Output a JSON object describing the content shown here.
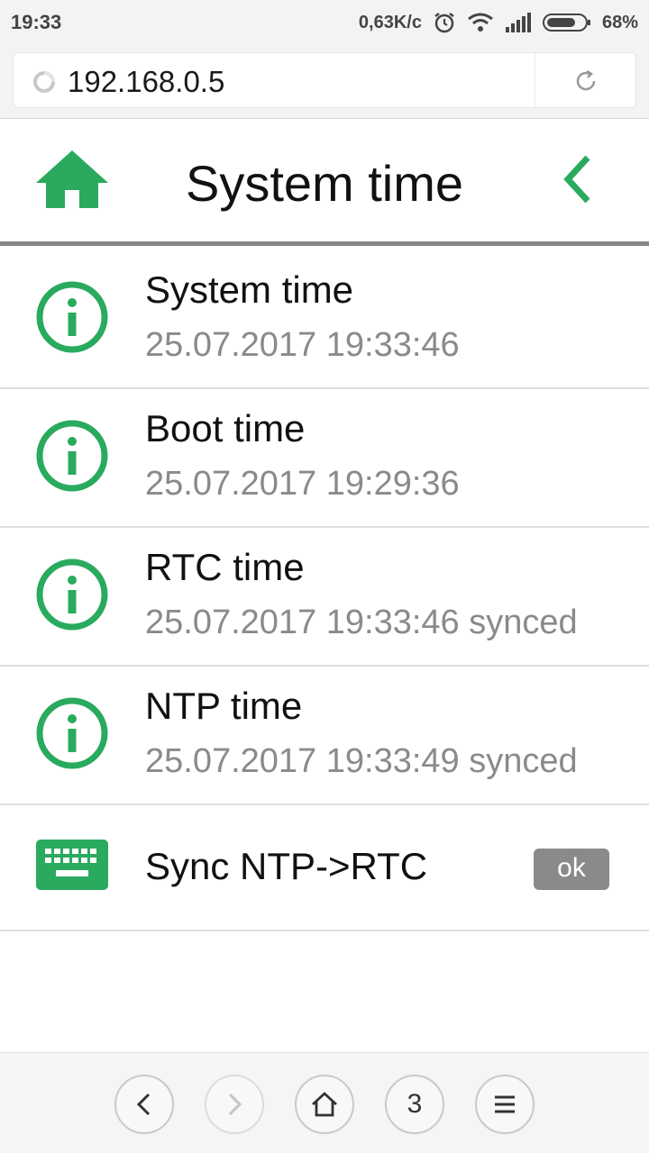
{
  "status_bar": {
    "time": "19:33",
    "net_speed": "0,63K/c",
    "battery": "68%",
    "icons": [
      "alarm-icon",
      "wifi-icon",
      "signal-icon",
      "battery-icon"
    ]
  },
  "browser": {
    "url": "192.168.0.5",
    "tab_count": "3"
  },
  "header": {
    "title": "System time"
  },
  "colors": {
    "accent": "#2aaa5e",
    "muted_text": "#8a8a8a",
    "button_gray": "#8a8a8a"
  },
  "rows": [
    {
      "label": "System time",
      "value": "25.07.2017 19:33:46",
      "icon": "info-icon"
    },
    {
      "label": "Boot time",
      "value": "25.07.2017 19:29:36",
      "icon": "info-icon"
    },
    {
      "label": "RTC time",
      "value": "25.07.2017 19:33:46 synced",
      "icon": "info-icon"
    },
    {
      "label": "NTP time",
      "value": "25.07.2017 19:33:49 synced",
      "icon": "info-icon"
    }
  ],
  "action": {
    "label": "Sync NTP->RTC",
    "button": "ok",
    "icon": "keyboard-icon"
  }
}
